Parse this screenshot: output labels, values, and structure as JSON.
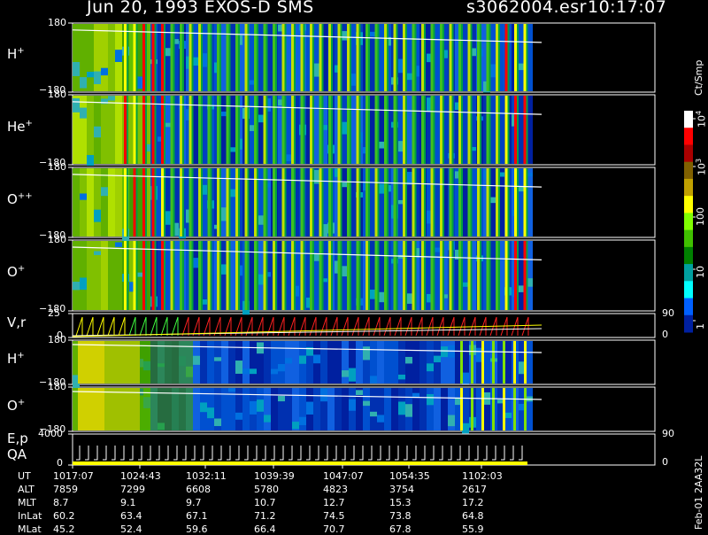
{
  "header": {
    "title": "Jun 20, 1993   EXOS-D SMS",
    "file": "s3062004.esr",
    "time": "10:17:07"
  },
  "chart_data": {
    "type": "heatmap",
    "panels": [
      {
        "label": "H",
        "sup": "+",
        "yticks": [
          "180",
          "−180"
        ],
        "ylim": [
          -180,
          180
        ]
      },
      {
        "label": "He",
        "sup": "+",
        "yticks": [
          "180",
          "−180"
        ],
        "ylim": [
          -180,
          180
        ]
      },
      {
        "label": "O",
        "sup": "++",
        "yticks": [
          "180",
          "−180"
        ],
        "ylim": [
          -180,
          180
        ]
      },
      {
        "label": "O",
        "sup": "+",
        "yticks": [
          "180",
          "−180"
        ],
        "ylim": [
          -180,
          180
        ]
      },
      {
        "label": "V,r",
        "sup": "",
        "yticks": [
          "25",
          "0"
        ],
        "rticks": [
          "90",
          "0"
        ]
      },
      {
        "label": "H",
        "sup": "+",
        "yticks": [
          "180",
          "−180"
        ],
        "ylim": [
          -180,
          180
        ]
      },
      {
        "label": "O",
        "sup": "+",
        "yticks": [
          "180",
          "−180"
        ],
        "ylim": [
          -180,
          180
        ]
      },
      {
        "label": "E,p",
        "label2": "QA",
        "sup": "",
        "yticks": [
          "4000",
          "0"
        ],
        "rticks": [
          "90",
          "0"
        ]
      }
    ],
    "colorbar": {
      "unit": "Ct/Smp",
      "ticks": [
        {
          "exp": "4"
        },
        {
          "exp": "3"
        },
        {
          "text": "100"
        },
        {
          "text": "10"
        },
        {
          "text": "1"
        }
      ],
      "colors": [
        "#ffffff",
        "#ff0000",
        "#aa0000",
        "#806000",
        "#c0a000",
        "#ffff00",
        "#80ff00",
        "#40c000",
        "#008000",
        "#00a0a0",
        "#00ffff",
        "#0060ff",
        "#0020a0"
      ]
    },
    "side_label": "Feb-01 2AA32L",
    "table": {
      "labels": [
        "UT",
        "ALT",
        "MLT",
        "InLat",
        "MLat"
      ],
      "columns": [
        [
          "1017:07",
          "7859",
          "8.7",
          "60.2",
          "45.2"
        ],
        [
          "1024:43",
          "7299",
          "9.1",
          "63.4",
          "52.4"
        ],
        [
          "1032:11",
          "6608",
          "9.7",
          "67.1",
          "59.6"
        ],
        [
          "1039:39",
          "5780",
          "10.7",
          "71.2",
          "66.4"
        ],
        [
          "1047:07",
          "4823",
          "12.7",
          "74.5",
          "70.7"
        ],
        [
          "1054:35",
          "3754",
          "15.3",
          "73.8",
          "67.8"
        ],
        [
          "1102:03",
          "2617",
          "17.2",
          "64.8",
          "55.9"
        ]
      ]
    }
  }
}
